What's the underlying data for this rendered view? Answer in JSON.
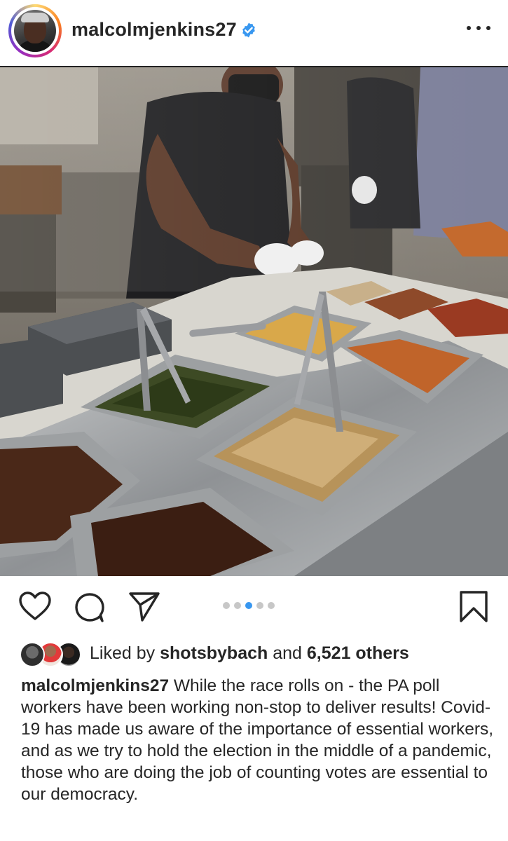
{
  "post": {
    "username": "malcolmjenkins27",
    "verified": true,
    "icons": {
      "verified": "verified-badge-icon",
      "more": "more-options-icon",
      "like": "heart-icon",
      "comment": "comment-icon",
      "share": "paper-plane-icon",
      "save": "bookmark-icon"
    },
    "photo_alt": "Food service workers behind a counter with trays of food",
    "carousel": {
      "total": 5,
      "active_index": 2
    },
    "likes": {
      "prefix": "Liked by",
      "user": "shotsbybach",
      "connector": "and",
      "count": "6,521 others"
    },
    "caption": {
      "username": "malcolmjenkins27",
      "text": "While the race rolls on - the PA poll workers have been working non-stop to deliver results! Covid-19 has made us aware of the importance of essential workers, and as we try to hold the election in the middle of a pandemic, those who are doing the job of counting votes are essential to our democracy."
    },
    "colors": {
      "text": "#262626",
      "verified": "#3897f0",
      "carousel_active": "#3897f0",
      "carousel_inactive": "#c7c7c7"
    }
  }
}
